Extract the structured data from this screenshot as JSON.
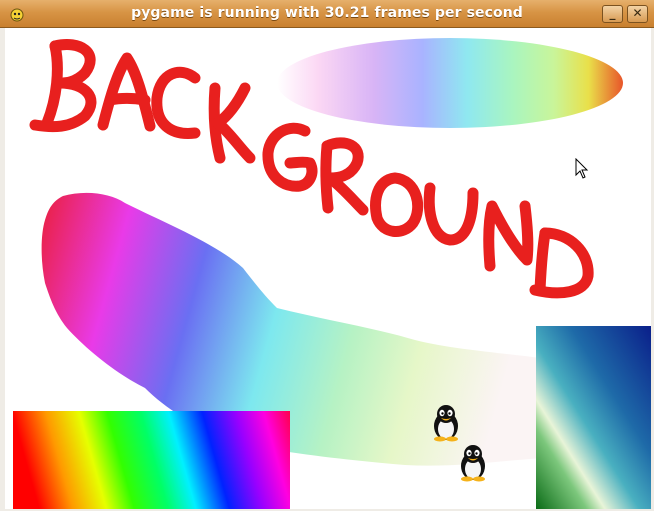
{
  "window": {
    "title": "pygame is running with 30.21 frames per second",
    "app_icon": "pygame-snake-icon",
    "minimize_icon": "minimize-icon",
    "close_icon": "close-icon",
    "minimize_label": "_",
    "close_label": "✕"
  },
  "canvas": {
    "background_text": "BACKGROUND",
    "background_text_color": "#e8201e",
    "background_color": "#ffffff",
    "sprites": [
      {
        "name": "penguin-sprite-1",
        "icon": "penguin-icon"
      },
      {
        "name": "penguin-sprite-2",
        "icon": "penguin-icon"
      }
    ],
    "cursor_icon": "mouse-pointer-icon"
  },
  "colors": {
    "titlebar": "#d79445",
    "title_text": "#ffffff",
    "hand_text": "#e8201e"
  }
}
